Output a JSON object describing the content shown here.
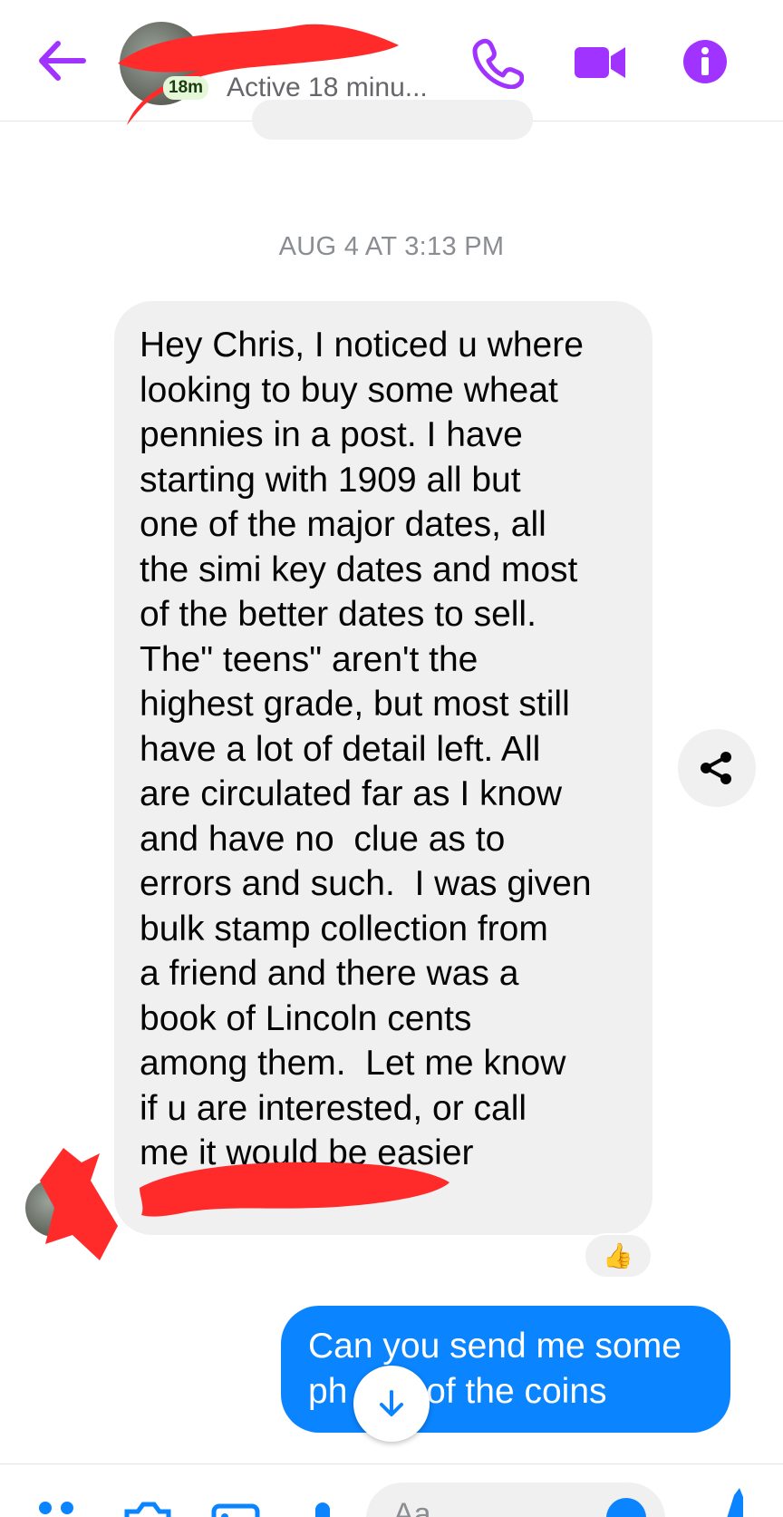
{
  "header": {
    "active_badge": "18m",
    "active_status": "Active 18 minu..."
  },
  "conversation": {
    "timestamp": "AUG 4 AT 3:13 PM",
    "incoming_message": "Hey Chris, I noticed u where\nlooking to buy some wheat\npennies in a post. I have\nstarting with 1909 all but\none of the major dates, all\nthe simi key dates and most\nof the better dates to sell.\nThe\" teens\" aren't the\nhighest grade, but most still\nhave a lot of detail left. All\nare circulated far as I know\nand have no  clue as to\nerrors and such.  I was given\nbulk stamp collection from\na friend and there was a\nbook of Lincoln cents\namong them.  Let me know\nif u are interested, or call\nme it would be easier",
    "reaction_emoji": "👍",
    "outgoing_message": "Can you send me some\nph        of the coins"
  },
  "composer": {
    "placeholder": "Aa"
  },
  "colors": {
    "accent": "#a033ff",
    "outgoing_bubble": "#0a84ff",
    "incoming_bubble": "#f0f0f0",
    "redaction": "#ff2b2b"
  },
  "icons": [
    "back-arrow-icon",
    "phone-icon",
    "video-icon",
    "info-icon",
    "share-icon",
    "thumbs-up-icon",
    "arrow-down-icon",
    "menu-icon",
    "camera-icon",
    "image-icon",
    "mic-icon",
    "emoji-icon",
    "like-icon"
  ]
}
